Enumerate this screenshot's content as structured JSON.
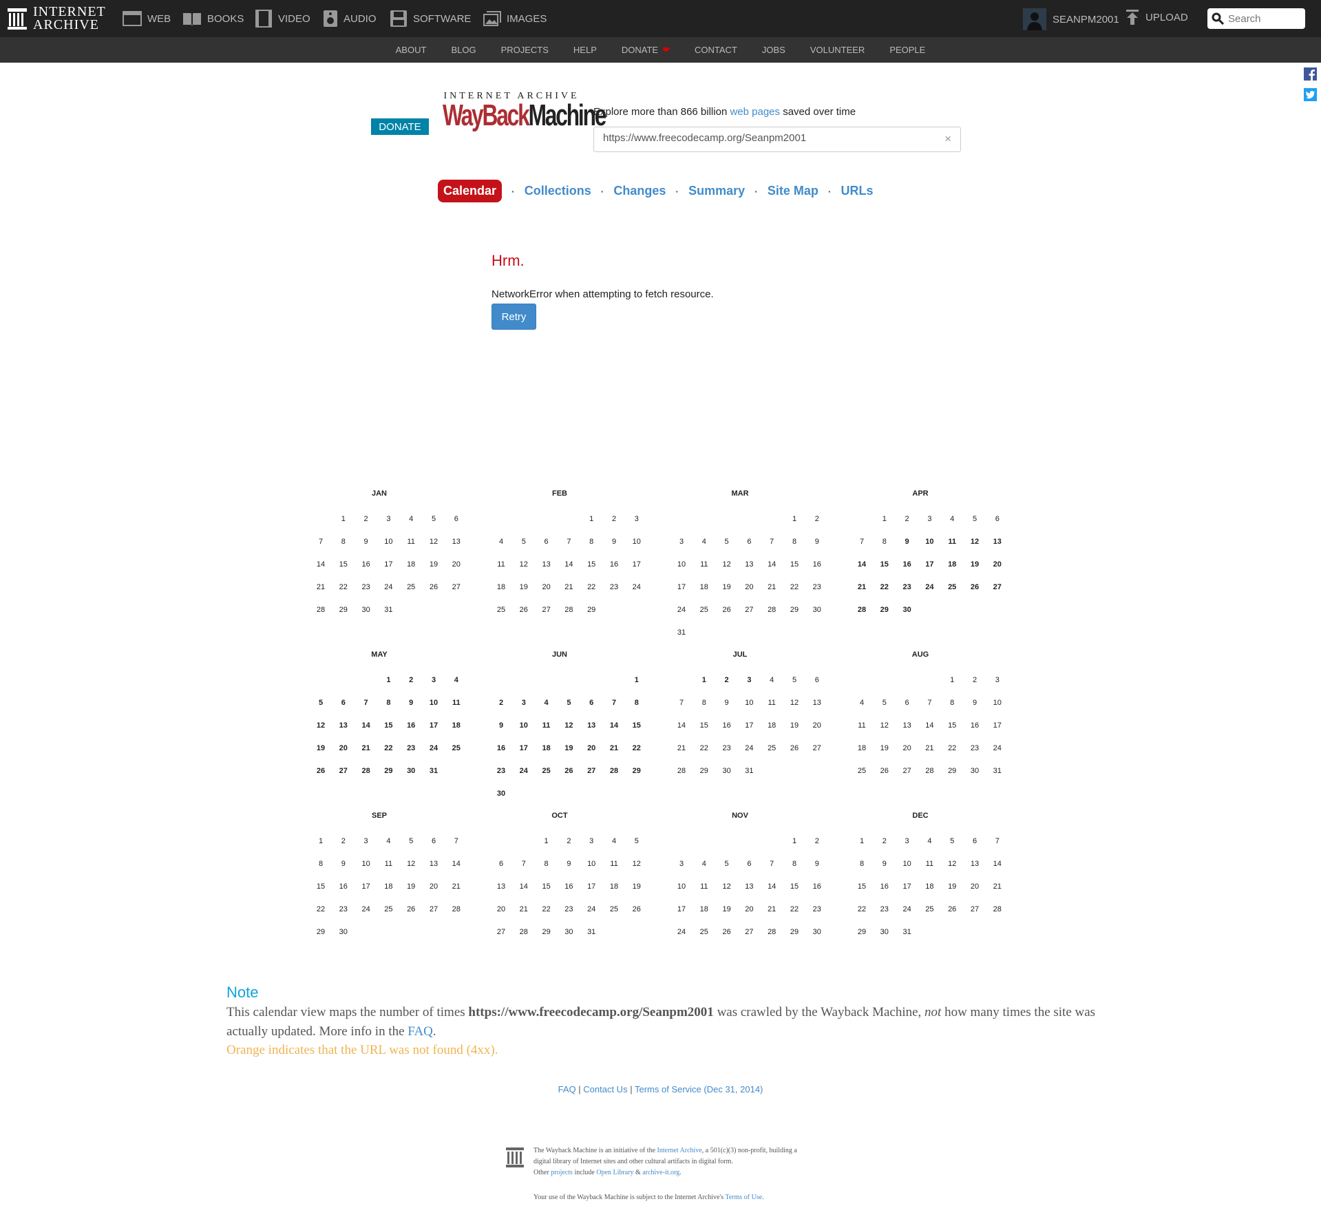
{
  "topbar": {
    "logo_line1": "INTERNET",
    "logo_line2": "ARCHIVE",
    "media": [
      {
        "label": "WEB",
        "icon": "web-icon"
      },
      {
        "label": "BOOKS",
        "icon": "books-icon"
      },
      {
        "label": "VIDEO",
        "icon": "video-icon"
      },
      {
        "label": "AUDIO",
        "icon": "audio-icon"
      },
      {
        "label": "SOFTWARE",
        "icon": "software-icon"
      },
      {
        "label": "IMAGES",
        "icon": "images-icon"
      }
    ],
    "username": "SEANPM2001",
    "upload_label": "UPLOAD",
    "search_placeholder": "Search"
  },
  "subnav": [
    "ABOUT",
    "BLOG",
    "PROJECTS",
    "HELP",
    "DONATE",
    "CONTACT",
    "JOBS",
    "VOLUNTEER",
    "PEOPLE"
  ],
  "wayback": {
    "donate_label": "DONATE",
    "logo_top": "INTERNET ARCHIVE",
    "logo_wayback": "WayBack",
    "logo_machine": "Machine",
    "explore_prefix": "Explore more than 866 billion",
    "explore_link": "web pages",
    "explore_suffix": "saved over time",
    "url_value": "https://www.freecodecamp.org/Seanpm2001",
    "clear_glyph": "×"
  },
  "tabs": [
    "Calendar",
    "Collections",
    "Changes",
    "Summary",
    "Site Map",
    "URLs"
  ],
  "error": {
    "title": "Hrm.",
    "message": "NetworkError when attempting to fetch resource.",
    "retry_label": "Retry"
  },
  "calendar": {
    "colors": {
      "capture": "#fde1a6"
    },
    "highlighted_day": {
      "month": "APR",
      "day": 9
    },
    "months": [
      {
        "name": "JAN",
        "start": 1,
        "days": 31,
        "captured": []
      },
      {
        "name": "FEB",
        "start": 4,
        "days": 29,
        "captured": []
      },
      {
        "name": "MAR",
        "start": 5,
        "days": 31,
        "captured": []
      },
      {
        "name": "APR",
        "start": 1,
        "days": 30,
        "captured": [
          9,
          10,
          11,
          12,
          13,
          14,
          15,
          16,
          17,
          18,
          19,
          20,
          21,
          22,
          23,
          24,
          25,
          26,
          27,
          28,
          29,
          30
        ]
      },
      {
        "name": "MAY",
        "start": 3,
        "days": 31,
        "captured": [
          1,
          2,
          3,
          4,
          5,
          6,
          7,
          8,
          9,
          10,
          11,
          12,
          13,
          14,
          15,
          16,
          17,
          18,
          19,
          20,
          21,
          22,
          23,
          24,
          25,
          26,
          27,
          28,
          29,
          30,
          31
        ]
      },
      {
        "name": "JUN",
        "start": 6,
        "days": 30,
        "captured": [
          1,
          2,
          3,
          4,
          5,
          6,
          7,
          8,
          9,
          10,
          11,
          12,
          13,
          14,
          15,
          16,
          17,
          18,
          19,
          20,
          21,
          22,
          23,
          24,
          25,
          26,
          27,
          28,
          29,
          30
        ]
      },
      {
        "name": "JUL",
        "start": 1,
        "days": 31,
        "captured": [
          1,
          2,
          3
        ]
      },
      {
        "name": "AUG",
        "start": 4,
        "days": 31,
        "captured": []
      },
      {
        "name": "SEP",
        "start": 0,
        "days": 30,
        "captured": []
      },
      {
        "name": "OCT",
        "start": 2,
        "days": 31,
        "captured": []
      },
      {
        "name": "NOV",
        "start": 5,
        "days": 30,
        "captured": []
      },
      {
        "name": "DEC",
        "start": 0,
        "days": 31,
        "captured": []
      }
    ]
  },
  "note": {
    "title": "Note",
    "text1": "This calendar view maps the number of times",
    "url": "https://www.freecodecamp.org/Seanpm2001",
    "text2": "was crawled by the Wayback Machine,",
    "not": "not",
    "text3": "how many times the site was actually updated. More info in the",
    "faq": "FAQ",
    "period": ".",
    "orange": "Orange indicates that the URL was not found (4xx)."
  },
  "footer": {
    "faq": "FAQ",
    "sep": "|",
    "contact": "Contact Us",
    "terms": "Terms of Service (Dec 31, 2014)",
    "line1a": "The Wayback Machine is an initiative of the",
    "line1_link": "Internet Archive",
    "line1b": ", a 501(c)(3) non-profit, building a digital library of Internet sites and other cultural artifacts in digital form.",
    "other": "Other",
    "projects": "projects",
    "include": "include",
    "open_library": "Open Library",
    "amp": "&",
    "archive_it": "archive-it.org",
    "dot": ".",
    "use_text": "Your use of the Wayback Machine is subject to the Internet Archive's",
    "terms_of_use": "Terms of Use",
    "use_dot": "."
  }
}
